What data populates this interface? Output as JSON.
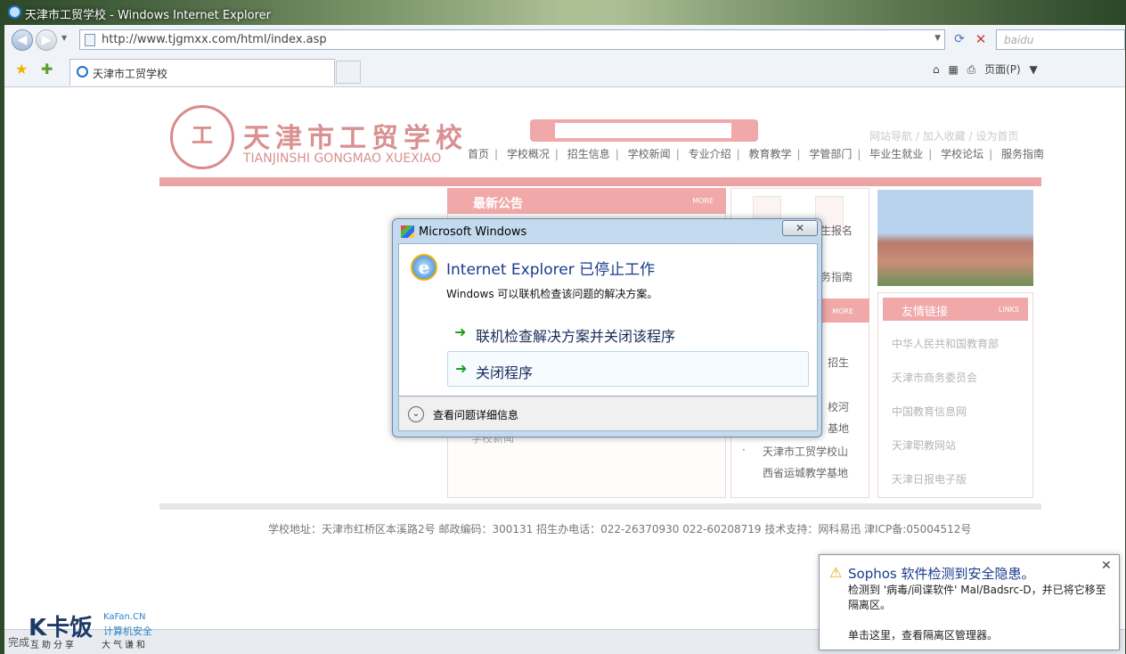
{
  "window": {
    "title": "天津市工贸学校 - Windows Internet Explorer"
  },
  "browser": {
    "url": "http://www.tjgmxx.com/html/index.asp",
    "search_placeholder": "baidu",
    "tab_title": "天津市工贸学校",
    "page_menu": "页面(P)",
    "status_text": "完成"
  },
  "site": {
    "name": "天津市工贸学校",
    "pinyin": "TIANJINSHI GONGMAO XUEXIAO",
    "top_links": [
      "网站导航",
      "加入收藏",
      "设为首页"
    ],
    "nav": [
      "首页",
      "学校概况",
      "招生信息",
      "学校新闻",
      "专业介绍",
      "教育教学",
      "学管部门",
      "毕业生就业",
      "学校论坛",
      "服务指南"
    ],
    "notice_title": "最新公告",
    "more_label": "MORE",
    "notice_item": "学校新闻",
    "mid_labels": [
      "生报名",
      "务指南"
    ],
    "mid_texts": [
      "招生",
      "校河",
      "基地",
      "天津市工贸学校山",
      "西省运城教学基地"
    ],
    "links_title": "友情链接",
    "links_tag": "LINKS",
    "links": [
      "中华人民共和国教育部",
      "天津市商务委员会",
      "中国教育信息网",
      "天津职教网站",
      "天津日报电子版"
    ],
    "footer": "学校地址：天津市红桥区本溪路2号 邮政编码：300131 招生办电话：022-26370930 022-60208719 技术支持：网科易迅 津ICP备:05004512号"
  },
  "dialog": {
    "title": "Microsoft Windows",
    "heading": "Internet Explorer 已停止工作",
    "subtext": "Windows 可以联机检查该问题的解决方案。",
    "option1": "联机检查解决方案并关闭该程序",
    "option2": "关闭程序",
    "details": "查看问题详细信息"
  },
  "toast": {
    "title": "Sophos 软件检测到安全隐患。",
    "body": "检测到 '病毒/间谍软件' Mal/Badsrc-D，并已将它移至隔离区。",
    "link": "单击这里，查看隔离区管理器。"
  },
  "watermark": {
    "brand": "卡饭",
    "domain": "KaFan.CN",
    "subtitle": "计算机安全",
    "slogan1": "互助分享",
    "slogan2": "大气谦和"
  }
}
